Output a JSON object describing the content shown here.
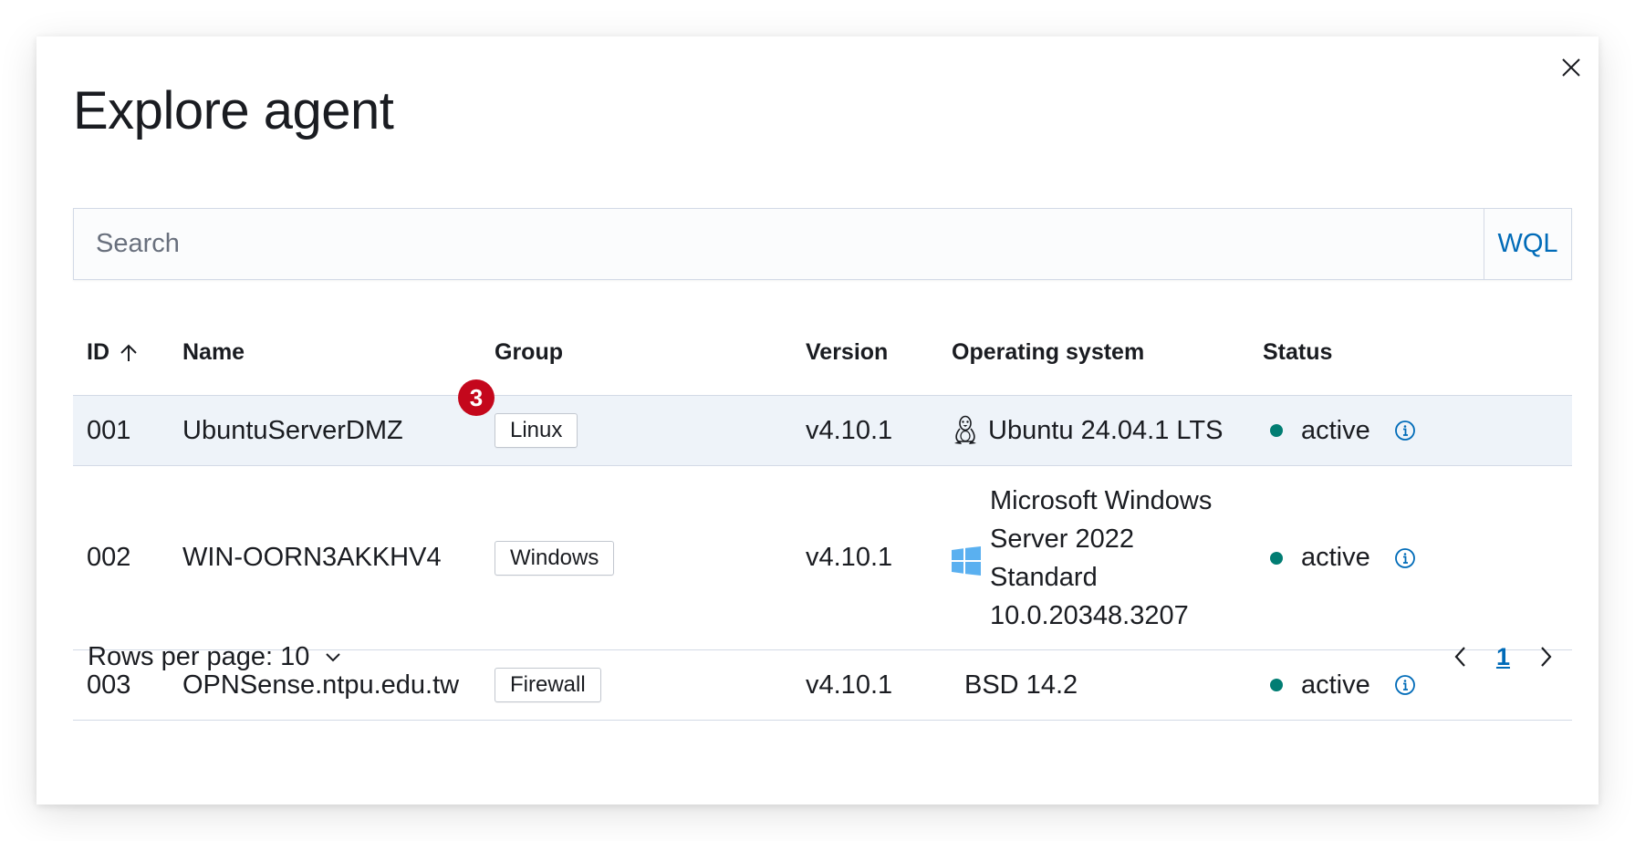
{
  "modal": {
    "title": "Explore agent"
  },
  "search": {
    "placeholder": "Search",
    "wql_label": "WQL"
  },
  "table": {
    "columns": {
      "id": "ID",
      "name": "Name",
      "group": "Group",
      "version": "Version",
      "os": "Operating system",
      "status": "Status"
    },
    "rows": [
      {
        "id": "001",
        "name": "UbuntuServerDMZ",
        "group": "Linux",
        "version": "v4.10.1",
        "os_line1": "Ubuntu 24.04.1 LTS",
        "os_icon": "linux-tux-icon",
        "status": "active"
      },
      {
        "id": "002",
        "name": "WIN-OORN3AKKHV4",
        "group": "Windows",
        "version": "v4.10.1",
        "os_line1": "Microsoft Windows",
        "os_line2": "Server 2022",
        "os_line3": "Standard",
        "os_line4": "10.0.20348.3207",
        "os_icon": "windows-icon",
        "status": "active"
      },
      {
        "id": "003",
        "name": "OPNSense.ntpu.edu.tw",
        "group": "Firewall",
        "version": "v4.10.1",
        "os_line1": "BSD 14.2",
        "status": "active"
      }
    ]
  },
  "notification_badge": "3",
  "footer": {
    "rows_per_page": "Rows per page: 10",
    "current_page": "1"
  },
  "colors": {
    "status_active": "#017d73",
    "link": "#006bb8",
    "badge_red": "#c4071c",
    "row_highlight": "#eef3f9"
  }
}
